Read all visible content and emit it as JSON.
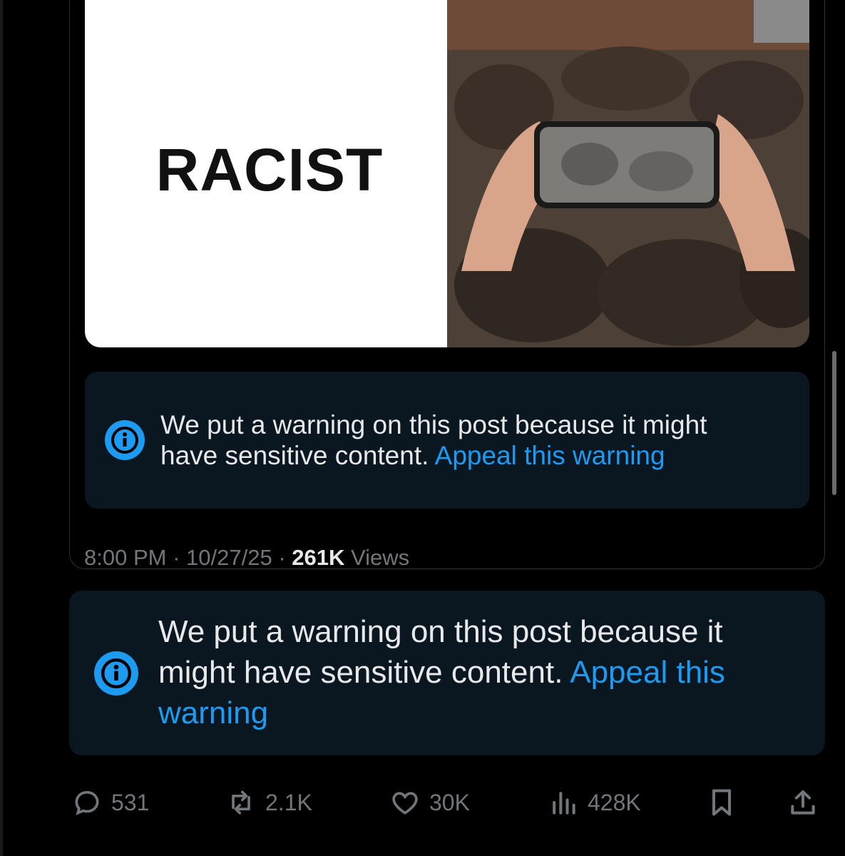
{
  "media": {
    "left_panel_text": "RACIST"
  },
  "quote_warning": {
    "text": "We put a warning on this post because it might have sensitive content.",
    "link": "Appeal this warning"
  },
  "post_meta": {
    "time": "8:00 PM",
    "date": "10/27/25",
    "views_count": "261K",
    "views_label": "Views",
    "separator": "·"
  },
  "post_warning": {
    "text": "We put a warning on this post because it might have sensitive content.",
    "link": "Appeal this warning"
  },
  "actions": {
    "replies": "531",
    "reposts": "2.1K",
    "likes": "30K",
    "views": "428K"
  },
  "colors": {
    "background": "#000000",
    "accent": "#1d9bf0",
    "muted": "#71767b",
    "warning_bg": "#0a1620"
  },
  "icons": {
    "info": "info-icon",
    "reply": "reply-icon",
    "repost": "repost-icon",
    "like": "heart-icon",
    "views": "views-icon",
    "bookmark": "bookmark-icon",
    "share": "share-icon"
  }
}
